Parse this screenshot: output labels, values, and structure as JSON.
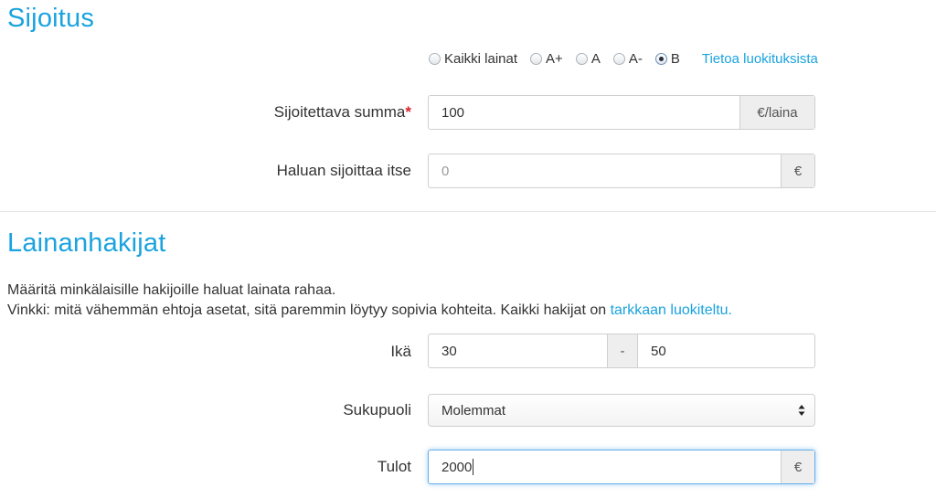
{
  "sections": {
    "investment_title": "Sijoitus",
    "applicants_title": "Lainanhakijat"
  },
  "rating_filter": {
    "options": [
      "Kaikki lainat",
      "A+",
      "A",
      "A-",
      "B"
    ],
    "selected": "B",
    "info_link": "Tietoa luokituksista"
  },
  "investment_amount": {
    "label": "Sijoitettava summa",
    "required_mark": "*",
    "value": "100",
    "unit": "€/laina"
  },
  "self_invest": {
    "label": "Haluan sijoittaa itse",
    "placeholder": "0",
    "unit": "€"
  },
  "applicants_intro": {
    "line1": "Määritä minkälaisille hakijoille haluat lainata rahaa.",
    "line2_prefix": "Vinkki: mitä vähemmän ehtoja asetat, sitä paremmin löytyy sopivia kohteita. Kaikki hakijat on ",
    "line2_link": "tarkkaan luokiteltu."
  },
  "age": {
    "label": "Ikä",
    "min": "30",
    "separator": "-",
    "max": "50"
  },
  "gender": {
    "label": "Sukupuoli",
    "selected": "Molemmat"
  },
  "income": {
    "label": "Tulot",
    "value": "2000",
    "unit": "€"
  },
  "colors": {
    "accent": "#1aa3df",
    "required": "#d9232d",
    "focus_border": "#66afe9"
  }
}
